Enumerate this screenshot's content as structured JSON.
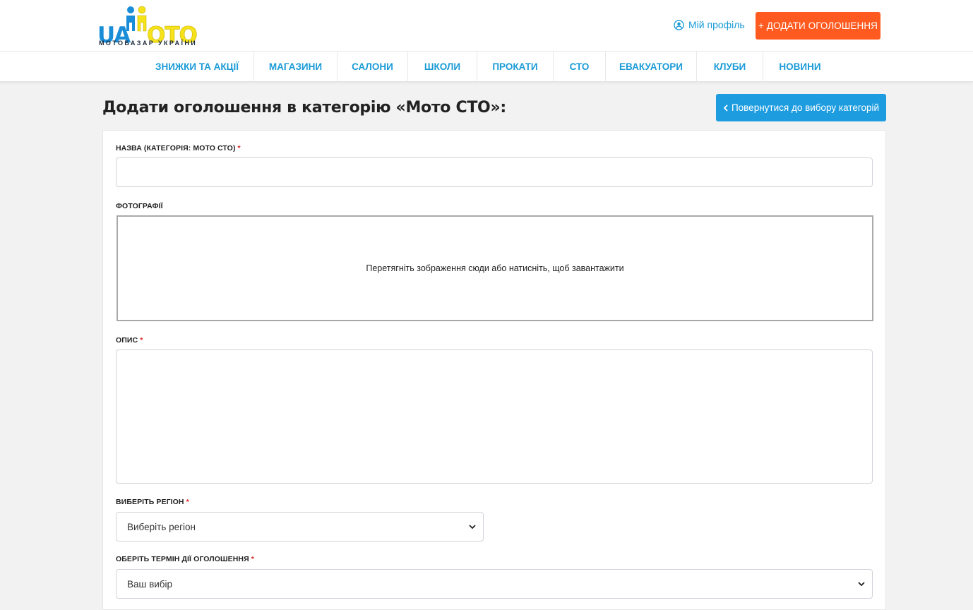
{
  "header": {
    "logo": {
      "ua": "UA",
      "moto": "OTO",
      "tagline": "МОТОБАЗАР УКРАЇНИ"
    },
    "profile_label": "Мій профіль",
    "add_button_label": "+ ДОДАТИ ОГОЛОШЕННЯ",
    "accent_color": "#1a9bd7",
    "cta_color": "#ff5a1f"
  },
  "nav": {
    "items": [
      {
        "label": "ЗНИЖКИ ТА АКЦІЇ"
      },
      {
        "label": "МАГАЗИНИ"
      },
      {
        "label": "САЛОНИ"
      },
      {
        "label": "ШКОЛИ"
      },
      {
        "label": "ПРОКАТИ"
      },
      {
        "label": "СТО"
      },
      {
        "label": "ЕВАКУАТОРИ"
      },
      {
        "label": "КЛУБИ"
      },
      {
        "label": "НОВИНИ"
      }
    ]
  },
  "page": {
    "title": "Додати оголошення в категорію «Мото СТО»:",
    "back_button_label": "Повернутися до вибору категорій"
  },
  "form": {
    "name_label": "НАЗВА (КАТЕГОРІЯ: МОТО СТО)",
    "name_value": "",
    "photos_label": "ФОТОГРАФІЇ",
    "dropzone_text": "Перетягніть зображення сюди або натисніть, щоб завантажити",
    "description_label": "ОПИС",
    "description_value": "",
    "region_label": "ВИБЕРІТЬ РЕГІОН",
    "region_value": "Виберіть регіон",
    "term_label": "ОБЕРІТЬ ТЕРМІН ДІЇ ОГОЛОШЕННЯ",
    "term_value": "Ваш вибір",
    "required_mark": "*"
  }
}
